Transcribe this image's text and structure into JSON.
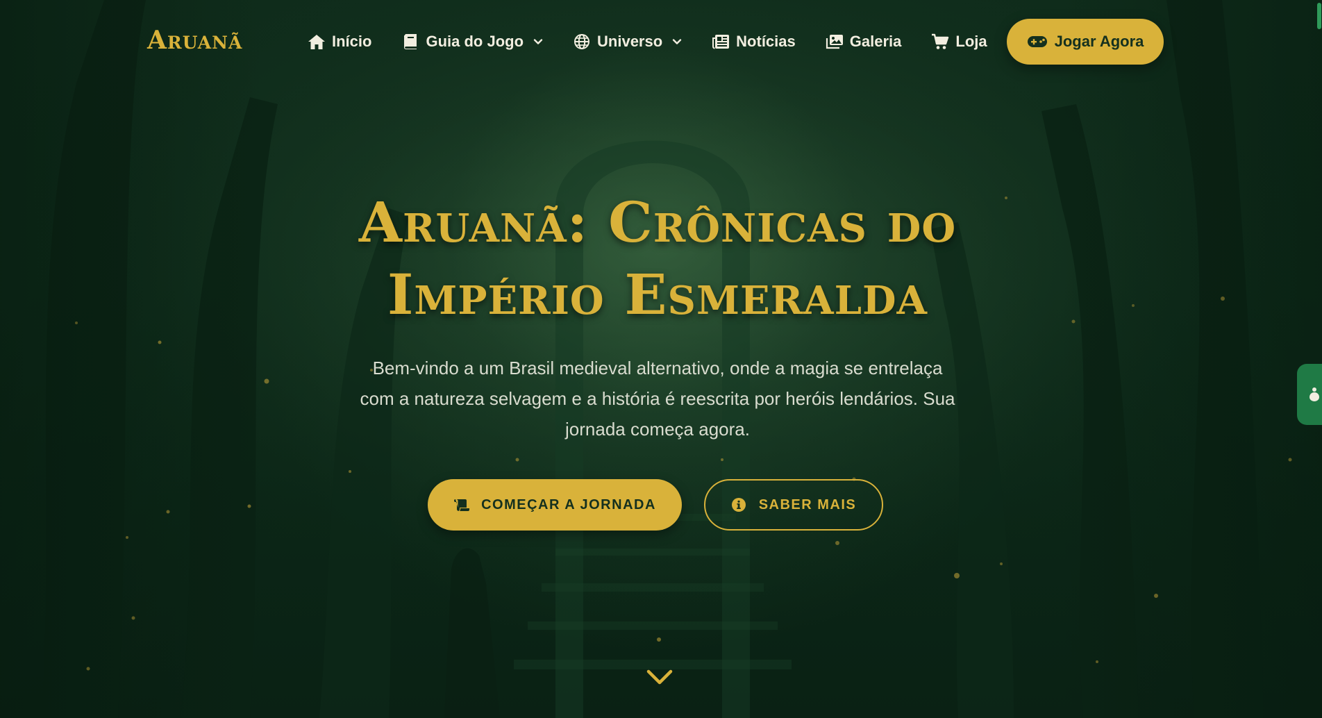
{
  "brand": {
    "name": "Aruanã"
  },
  "nav": {
    "items": [
      {
        "label": "Início",
        "icon": "home-icon",
        "dropdown": false
      },
      {
        "label": "Guia do Jogo",
        "icon": "book-icon",
        "dropdown": true
      },
      {
        "label": "Universo",
        "icon": "globe-icon",
        "dropdown": true
      },
      {
        "label": "Notícias",
        "icon": "newspaper-icon",
        "dropdown": false
      },
      {
        "label": "Galeria",
        "icon": "images-icon",
        "dropdown": false
      },
      {
        "label": "Loja",
        "icon": "cart-icon",
        "dropdown": false
      }
    ],
    "cta": {
      "label": "Jogar Agora",
      "icon": "gamepad-icon"
    }
  },
  "hero": {
    "title_line1": "Aruanã: Crônicas do",
    "title_line2": "Império Esmeralda",
    "subtitle": "Bem-vindo a um Brasil medieval alternativo, onde a magia se entrelaça com a natureza selvagem e a história é reescrita por heróis lendários. Sua jornada começa agora.",
    "primary_button": {
      "label": "COMEÇAR A JORNADA",
      "icon": "scroll-icon"
    },
    "secondary_button": {
      "label": "SABER MAIS",
      "icon": "info-circle-icon"
    },
    "scroll_icon": "chevron-down-icon"
  },
  "colors": {
    "accent_gold": "#d9b23a",
    "background_green": "#0e2b1a",
    "side_tab_green": "#1f7a45"
  }
}
